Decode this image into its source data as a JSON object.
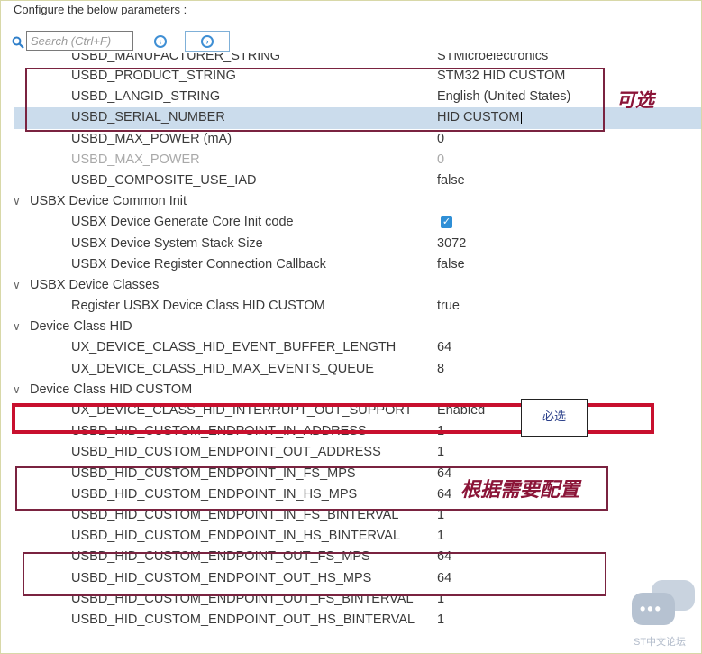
{
  "header": {
    "text": "Configure the below parameters :"
  },
  "toolbar": {
    "search_placeholder": "Search (Ctrl+F)",
    "prev_icon": "circle-arrow-left-icon",
    "next_icon": "circle-arrow-right-icon"
  },
  "rows": [
    {
      "label": "USBD_MANUFACTURER_STRING",
      "value": "STMicroelectronics"
    },
    {
      "label": "USBD_PRODUCT_STRING",
      "value": "STM32 HID CUSTOM"
    },
    {
      "label": "USBD_LANGID_STRING",
      "value": "English (United States)"
    },
    {
      "label": "USBD_SERIAL_NUMBER",
      "value": "HID CUSTOM"
    },
    {
      "label": "USBD_MAX_POWER (mA)",
      "value": "0"
    },
    {
      "label": "USBD_MAX_POWER",
      "value": "0"
    },
    {
      "label": "USBD_COMPOSITE_USE_IAD",
      "value": "false"
    },
    {
      "label": "USBX Device Common Init"
    },
    {
      "label": "USBX Device Generate Core Init code",
      "checked": true
    },
    {
      "label": "USBX Device System Stack Size",
      "value": "3072"
    },
    {
      "label": "USBX Device Register Connection Callback",
      "value": "false"
    },
    {
      "label": "USBX Device Classes"
    },
    {
      "label": "Register USBX Device Class HID CUSTOM",
      "value": "true"
    },
    {
      "label": "Device Class HID"
    },
    {
      "label": "UX_DEVICE_CLASS_HID_EVENT_BUFFER_LENGTH",
      "value": "64"
    },
    {
      "label": "UX_DEVICE_CLASS_HID_MAX_EVENTS_QUEUE",
      "value": "8"
    },
    {
      "label": "Device Class HID CUSTOM"
    },
    {
      "label": "UX_DEVICE_CLASS_HID_INTERRUPT_OUT_SUPPORT",
      "value": "Enabled"
    },
    {
      "label": "USBD_HID_CUSTOM_ENDPOINT_IN_ADDRESS",
      "value": "1"
    },
    {
      "label": "USBD_HID_CUSTOM_ENDPOINT_OUT_ADDRESS",
      "value": "1"
    },
    {
      "label": "USBD_HID_CUSTOM_ENDPOINT_IN_FS_MPS",
      "value": "64"
    },
    {
      "label": "USBD_HID_CUSTOM_ENDPOINT_IN_HS_MPS",
      "value": "64"
    },
    {
      "label": "USBD_HID_CUSTOM_ENDPOINT_IN_FS_BINTERVAL",
      "value": "1"
    },
    {
      "label": "USBD_HID_CUSTOM_ENDPOINT_IN_HS_BINTERVAL",
      "value": "1"
    },
    {
      "label": "USBD_HID_CUSTOM_ENDPOINT_OUT_FS_MPS",
      "value": "64"
    },
    {
      "label": "USBD_HID_CUSTOM_ENDPOINT_OUT_HS_MPS",
      "value": "64"
    },
    {
      "label": "USBD_HID_CUSTOM_ENDPOINT_OUT_FS_BINTERVAL",
      "value": "1"
    },
    {
      "label": "USBD_HID_CUSTOM_ENDPOINT_OUT_HS_BINTERVAL",
      "value": "1"
    }
  ],
  "annotations": {
    "optional": "可选",
    "required": "必选",
    "as_needed": "根据需要配置",
    "optional_color": "#7a2340",
    "required_color": "#c8102e"
  },
  "watermark": {
    "text": "ST中文论坛"
  },
  "colors": {
    "selected_row_bg": "#cbdcec",
    "checkbox": "#2f8fd6",
    "nav_accent": "#3f8fd4"
  }
}
